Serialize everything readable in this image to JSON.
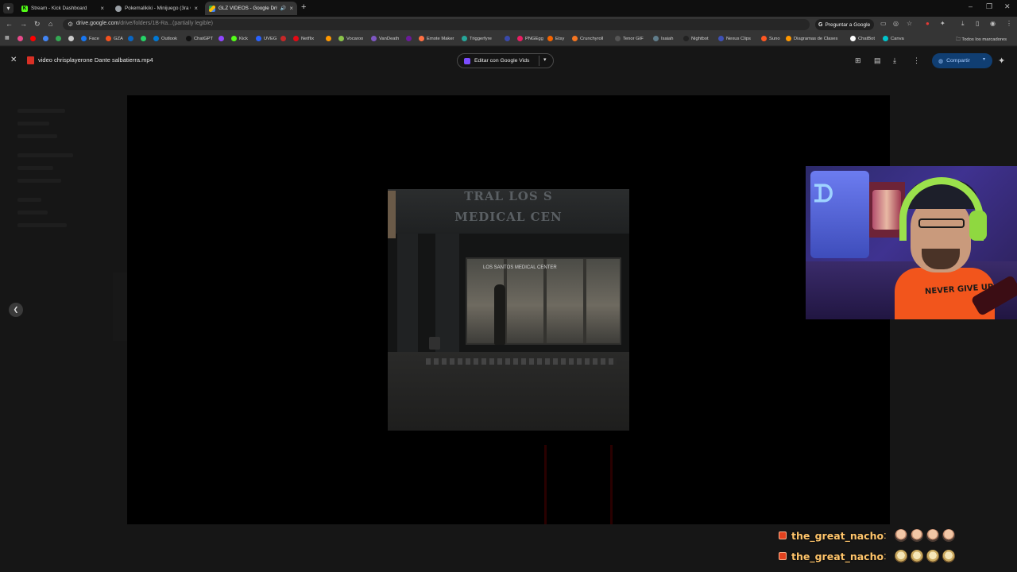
{
  "tabs": [
    {
      "title": "Stream - Kick Dashboard",
      "favicon": "kick-icon",
      "color": "#53fc18",
      "active": false
    },
    {
      "title": "Pokemalikiki - Minijuego (3ra G",
      "favicon": "globe-icon",
      "color": "#9aa0a6",
      "active": false
    },
    {
      "title": "GLZ VIDEOS - Google Drive",
      "favicon": "drive-icon",
      "color": "#4285f4",
      "active": true
    }
  ],
  "address_bar": {
    "url_host": "drive.google.com",
    "url_path": "/drive/folders/1B-Ra...(partially legible)",
    "ask_google": "Preguntar a Google"
  },
  "bookmarks": [
    {
      "label": "",
      "color": "#e84a8a"
    },
    {
      "label": "",
      "color": "#ff0000"
    },
    {
      "label": "",
      "color": "#4285f4"
    },
    {
      "label": "",
      "color": "#34a853"
    },
    {
      "label": "",
      "color": "#cccccc"
    },
    {
      "label": "Face",
      "color": "#1877f2"
    },
    {
      "label": "GZA",
      "color": "#f4511e"
    },
    {
      "label": "",
      "color": "#0a66c2"
    },
    {
      "label": "",
      "color": "#25d366"
    },
    {
      "label": "Outlook",
      "color": "#0078d4"
    },
    {
      "label": "ChatGPT",
      "color": "#111111"
    },
    {
      "label": "",
      "color": "#9146ff"
    },
    {
      "label": "Kick",
      "color": "#53fc18"
    },
    {
      "label": "UVEG",
      "color": "#2962ff"
    },
    {
      "label": "",
      "color": "#c62828"
    },
    {
      "label": "Netflix",
      "color": "#e50914"
    },
    {
      "label": "",
      "color": "#ff9800"
    },
    {
      "label": "Vocaroo",
      "color": "#8bc34a"
    },
    {
      "label": "VanDeath",
      "color": "#7e57c2"
    },
    {
      "label": "",
      "color": "#6a1b9a"
    },
    {
      "label": "Emote Maker",
      "color": "#ff7043"
    },
    {
      "label": "Triggerfyre",
      "color": "#26a69a"
    },
    {
      "label": "",
      "color": "#3949ab"
    },
    {
      "label": "PNGEgg",
      "color": "#e91e63"
    },
    {
      "label": "Etsy",
      "color": "#f56400"
    },
    {
      "label": "Crunchyroll",
      "color": "#f47521"
    },
    {
      "label": "Tenor GIF",
      "color": "#555555"
    },
    {
      "label": "Isaiah",
      "color": "#607d8b"
    },
    {
      "label": "Nightbot",
      "color": "#222222"
    },
    {
      "label": "Nexus Clips",
      "color": "#3f51b5"
    },
    {
      "label": "Suno",
      "color": "#ff5722"
    },
    {
      "label": "Diagramas de Clases",
      "color": "#ff9800"
    },
    {
      "label": "ChatBot",
      "color": "#ffffff"
    },
    {
      "label": "Canva",
      "color": "#00c4cc"
    }
  ],
  "bookmarks_all": "Todos los marcadores",
  "preview": {
    "file_name": "video chrisplayerone Dante salbatierra.mp4",
    "edit_button": "Editar con Google Vids",
    "share_button": "Compartir"
  },
  "video_frame": {
    "sign_line1": "TRAL LOS S",
    "sign_line2": "MEDICAL CEN",
    "inner_sign": "LOS SANTOS     MEDICAL CENTER"
  },
  "webcam": {
    "shirt_text": "NEVER GIVE UP"
  },
  "chat": [
    {
      "username": "the_great_nacho",
      "emote_type": "face",
      "emote_count": 4
    },
    {
      "username": "the_great_nacho",
      "emote_type": "dog",
      "emote_count": 4
    }
  ]
}
